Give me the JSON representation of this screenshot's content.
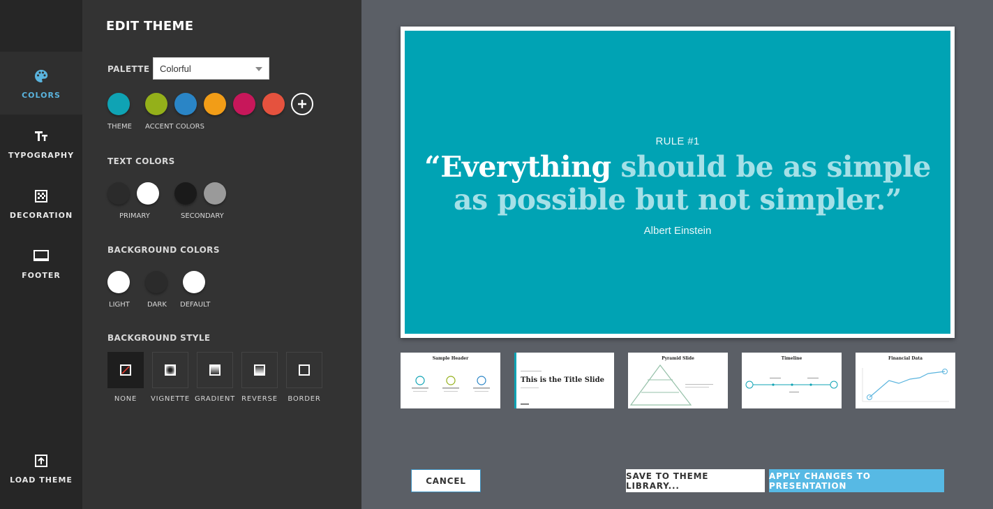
{
  "nav": {
    "items": [
      {
        "label": "COLORS",
        "icon": "palette-icon",
        "active": true
      },
      {
        "label": "TYPOGRAPHY",
        "icon": "text-size-icon",
        "active": false
      },
      {
        "label": "DECORATION",
        "icon": "pattern-icon",
        "active": false
      },
      {
        "label": "FOOTER",
        "icon": "monitor-icon",
        "active": false
      }
    ],
    "load_theme": {
      "label": "LOAD THEME",
      "icon": "upload-icon"
    }
  },
  "panel": {
    "title": "EDIT THEME",
    "palette": {
      "label": "PALETTE",
      "selected": "Colorful"
    },
    "theme_label": "THEME",
    "accent_label": "ACCENT COLORS",
    "theme_colors": {
      "theme": "#0fa3b4",
      "accents": [
        "#94b01a",
        "#2a85c6",
        "#f29d17",
        "#c7175a",
        "#e5523e"
      ]
    },
    "text_colors": {
      "label": "TEXT COLORS",
      "primary_label": "PRIMARY",
      "secondary_label": "SECONDARY",
      "primary": [
        "#2b2b2b",
        "#ffffff"
      ],
      "secondary": [
        "#1a1a1a",
        "#9a9a9a"
      ]
    },
    "background_colors": {
      "label": "BACKGROUND COLORS",
      "items": [
        {
          "label": "LIGHT",
          "color": "#ffffff"
        },
        {
          "label": "DARK",
          "color": "#2b2b2b"
        },
        {
          "label": "DEFAULT",
          "color": "#ffffff"
        }
      ]
    },
    "background_style": {
      "label": "BACKGROUND STYLE",
      "items": [
        "NONE",
        "VIGNETTE",
        "GRADIENT",
        "REVERSE",
        "BORDER"
      ],
      "selected": "NONE"
    }
  },
  "slide": {
    "rule": "RULE #1",
    "quote_open": "“",
    "quote_highlight": "Everything",
    "quote_rest": " should be as simple as possible but not simpler.",
    "quote_close": "”",
    "author": "Albert Einstein",
    "bg": "#00a3b4"
  },
  "thumbnails": [
    {
      "title": "Sample Header"
    },
    {
      "title": "This is the Title Slide"
    },
    {
      "title": "Pyramid Slide"
    },
    {
      "title": "Timeline"
    },
    {
      "title": "Financial Data"
    }
  ],
  "buttons": {
    "cancel": "CANCEL",
    "save": "SAVE TO THEME LIBRARY...",
    "apply": "APPLY CHANGES TO PRESENTATION"
  }
}
